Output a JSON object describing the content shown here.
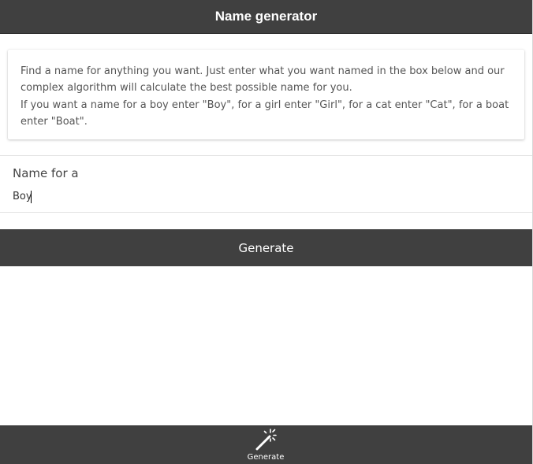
{
  "header": {
    "title": "Name generator"
  },
  "info": {
    "paragraph1": "Find a name for anything you want. Just enter what you want named in the box below and our complex algorithm will calculate the best possible name for you.",
    "paragraph2": "If you want a name for a boy enter \"Boy\", for a girl enter \"Girl\", for a cat enter \"Cat\", for a boat enter \"Boat\"."
  },
  "form": {
    "label": "Name for a",
    "value": "Boy"
  },
  "actions": {
    "generate_label": "Generate"
  },
  "bottom_nav": {
    "items": [
      {
        "label": "Generate",
        "icon": "magic-wand-icon"
      }
    ]
  },
  "colors": {
    "bar": "#404040",
    "text": "#444444",
    "on_bar": "#ffffff"
  }
}
